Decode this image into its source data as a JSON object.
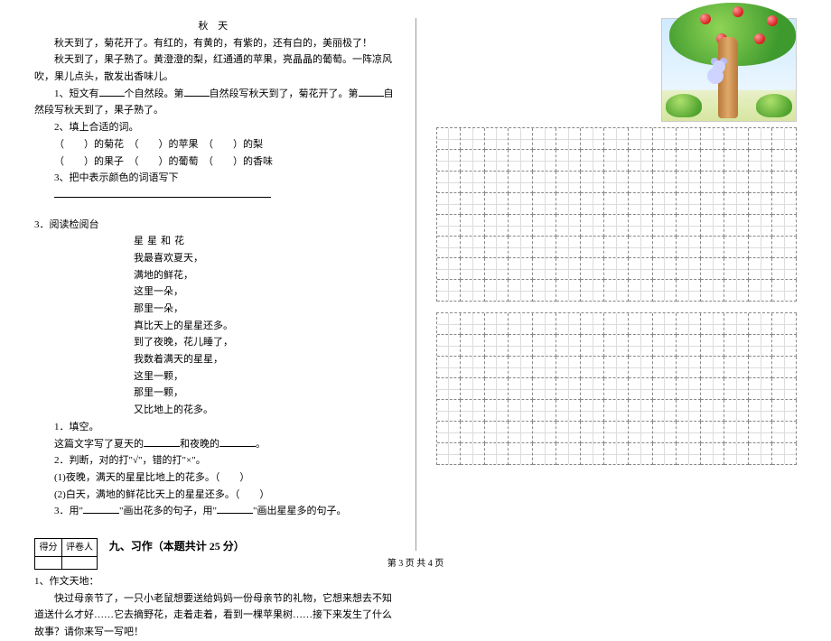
{
  "left": {
    "p1": {
      "title": "秋 天"
    },
    "p1_lines": [
      "秋天到了，菊花开了。有红的，有黄的，有紫的，还有白的，美丽极了！",
      "秋天到了，果子熟了。黄澄澄的梨，红通通的苹果，亮晶晶的葡萄。一阵凉风吹，果儿点头，散发出香味儿。"
    ],
    "q1": {
      "prefix": "1、短文有",
      "mid1": "个自然段。第",
      "mid2": "自然段写秋天到了，菊花开了。第",
      "mid3": "自然段写秋天到了，果子熟了。"
    },
    "q2_head": "2、填上合适的词。",
    "q2_lines": [
      "（　　）的菊花　（　　）的苹果　（　　）的梨",
      "（　　）的果子　（　　）的葡萄　（　　）的香味"
    ],
    "q3": "3、把中表示颜色的词语写下",
    "section3": "3．阅读检阅台",
    "poem_title": "星星和花",
    "poem": [
      "我最喜欢夏天，",
      "满地的鲜花，",
      "这里一朵，",
      "那里一朵，",
      "真比天上的星星还多。",
      "到了夜晚，花儿睡了，",
      "我数着满天的星星，",
      "这里一颗，",
      "那里一颗，",
      "又比地上的花多。"
    ],
    "pq1_head": "1．填空。",
    "pq1_line_a": "这篇文字写了夏天的",
    "pq1_line_b": "和夜晚的",
    "pq1_line_c": "。",
    "pq2_head": "2．判断，对的打\"√\"，错的打\"×\"。",
    "pq2_1": "(1)夜晚，满天的星星比地上的花多。（　　）",
    "pq2_2": "(2)白天，满地的鲜花比天上的星星还多。（　　）",
    "pq3_a": "3．用\"",
    "pq3_b": "\"画出花多的句子，用\"",
    "pq3_c": "\"画出星星多的句子。",
    "score": {
      "c1": "得分",
      "c2": "评卷人"
    },
    "section9": "九、习作（本题共计 25 分）",
    "essay_head": "1、作文天地：",
    "essay_body": "快过母亲节了，一只小老鼠想要送给妈妈一份母亲节的礼物，它想来想去不知道送什么才好……它去摘野花，走着走着，看到一棵苹果树……接下来发生了什么故事？请你来写一写吧！"
  },
  "footer": "第 3 页 共 4 页"
}
